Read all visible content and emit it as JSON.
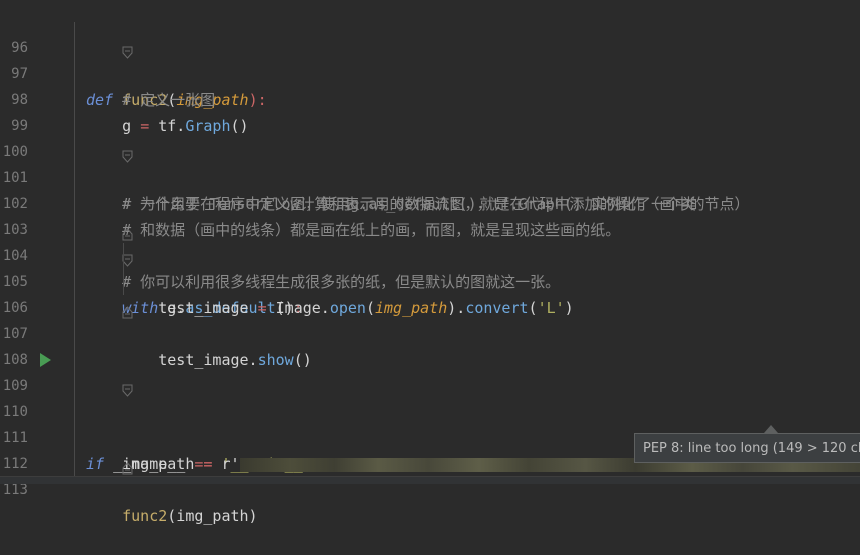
{
  "lines": [
    {
      "num": "96",
      "parts": [
        {
          "t": "def",
          "c": "kw"
        },
        {
          "t": " ",
          "c": ""
        },
        {
          "t": "func2",
          "c": "fn"
        },
        {
          "t": "(",
          "c": "var"
        },
        {
          "t": "img_path",
          "c": "param"
        },
        {
          "t": "):",
          "c": "op"
        }
      ]
    },
    {
      "num": "97",
      "parts": [
        {
          "t": "    # 定义一张图",
          "c": "com"
        }
      ]
    },
    {
      "num": "98",
      "parts": [
        {
          "t": "    g ",
          "c": "var"
        },
        {
          "t": "=",
          "c": "op"
        },
        {
          "t": " tf.",
          "c": "var"
        },
        {
          "t": "Graph",
          "c": "meth"
        },
        {
          "t": "()",
          "c": "var"
        }
      ]
    },
    {
      "num": "99",
      "parts": []
    },
    {
      "num": "100",
      "parts": [
        {
          "t": "    # 为什么要在程序中定义图，使用g.as_default()，tf.Graph() 实例化了一个类",
          "c": "com"
        }
      ]
    },
    {
      "num": "101",
      "parts": [
        {
          "t": "    # 一个用于 TensorFlow计算和表示用的数据流图，就是在代码中添加的操作（画中的节点）",
          "c": "com"
        }
      ]
    },
    {
      "num": "102",
      "parts": [
        {
          "t": "    # 和数据（画中的线条）都是画在纸上的画，而图，就是呈现这些画的纸。",
          "c": "com"
        }
      ]
    },
    {
      "num": "103",
      "parts": [
        {
          "t": "    # 你可以利用很多线程生成很多张的纸，但是默认的图就这一张。",
          "c": "com"
        }
      ]
    },
    {
      "num": "104",
      "parts": [
        {
          "t": "    ",
          "c": ""
        },
        {
          "t": "with",
          "c": "kw"
        },
        {
          "t": " g.",
          "c": "var"
        },
        {
          "t": "as_default",
          "c": "meth"
        },
        {
          "t": "()",
          "c": "var"
        },
        {
          "t": ":",
          "c": "op"
        }
      ]
    },
    {
      "num": "105",
      "parts": [
        {
          "t": "        test_image ",
          "c": "var"
        },
        {
          "t": "=",
          "c": "op"
        },
        {
          "t": " Image.",
          "c": "var"
        },
        {
          "t": "open",
          "c": "meth"
        },
        {
          "t": "(",
          "c": "var"
        },
        {
          "t": "img_path",
          "c": "param"
        },
        {
          "t": ").",
          "c": "var"
        },
        {
          "t": "convert",
          "c": "meth"
        },
        {
          "t": "(",
          "c": "var"
        },
        {
          "t": "'L'",
          "c": "str"
        },
        {
          "t": ")",
          "c": "var"
        }
      ]
    },
    {
      "num": "106",
      "parts": [
        {
          "t": "        test_image.",
          "c": "var"
        },
        {
          "t": "show",
          "c": "meth"
        },
        {
          "t": "()",
          "c": "var"
        }
      ]
    },
    {
      "num": "107",
      "parts": []
    },
    {
      "num": "108",
      "parts": []
    },
    {
      "num": "109",
      "parts": [
        {
          "t": "if",
          "c": "kw"
        },
        {
          "t": " __name__ ",
          "c": "var"
        },
        {
          "t": "==",
          "c": "op"
        },
        {
          "t": " ",
          "c": ""
        },
        {
          "t": "'__main__'",
          "c": "str"
        },
        {
          "t": ":",
          "c": "op"
        }
      ]
    },
    {
      "num": "110",
      "parts": []
    },
    {
      "num": "111",
      "parts": [
        {
          "t": "    img_path ",
          "c": "var"
        },
        {
          "t": "=",
          "c": "op"
        },
        {
          "t": " r'",
          "c": "var"
        }
      ],
      "redacted": true
    },
    {
      "num": "112",
      "parts": [
        {
          "t": "    func2",
          "c": "fn"
        },
        {
          "t": "(img_path)",
          "c": "var"
        }
      ]
    },
    {
      "num": "113",
      "parts": []
    }
  ],
  "tooltip": {
    "text": "PEP 8: line too long (149 > 120 characters)"
  },
  "icons": {
    "run": "run-gutter-icon",
    "fold": "fold-marker-icon"
  },
  "colors": {
    "background": "#2b2b2b",
    "keyword": "#6b8fd6",
    "comment": "#8a8a8a",
    "string": "#b0b060"
  }
}
